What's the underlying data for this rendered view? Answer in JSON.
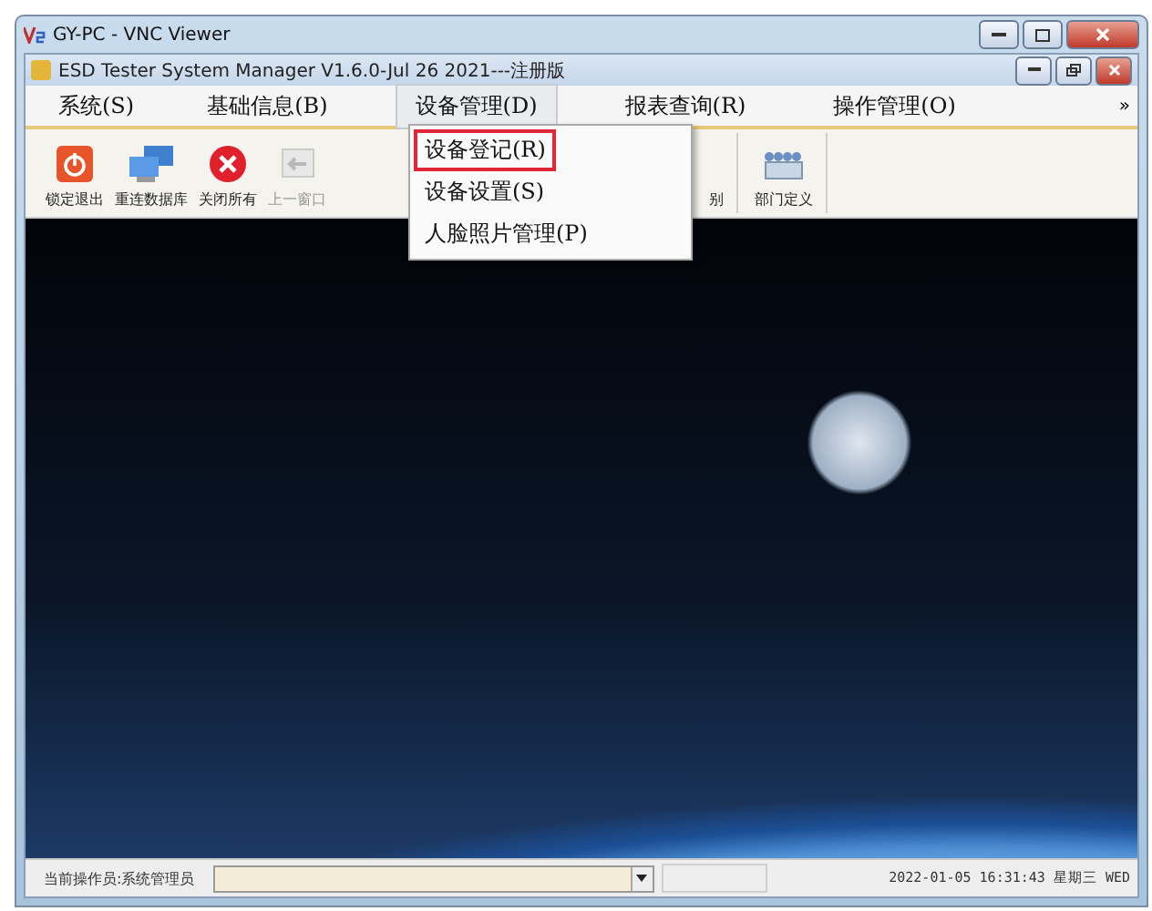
{
  "viewer_window": {
    "title": "GY-PC - VNC Viewer"
  },
  "app_window": {
    "title": "ESD Tester System Manager V1.6.0-Jul 26 2021---注册版"
  },
  "menu_bar": [
    {
      "label": "系统(S)",
      "open": false
    },
    {
      "label": "基础信息(B)",
      "open": false
    },
    {
      "label": "设备管理(D)",
      "open": true
    },
    {
      "label": "报表查询(R)",
      "open": false
    },
    {
      "label": "操作管理(O)",
      "open": false
    }
  ],
  "menu_overflow": "»",
  "dropdown": [
    {
      "label": "设备登记(R)",
      "selected": true
    },
    {
      "label": "设备设置(S)",
      "selected": false
    },
    {
      "label": "人脸照片管理(P)",
      "selected": false
    }
  ],
  "toolbar": [
    {
      "kind": "lock",
      "label": "锁定退出",
      "disabled": false
    },
    {
      "kind": "database",
      "label": "重连数据库",
      "disabled": false
    },
    {
      "kind": "close",
      "label": "关闭所有",
      "disabled": false
    },
    {
      "kind": "back",
      "label": "上一窗口",
      "disabled": true
    },
    {
      "kind": "covered",
      "label": "别",
      "disabled": false
    },
    {
      "kind": "people",
      "label": "部门定义",
      "disabled": false
    }
  ],
  "status_bar": {
    "operator": "当前操作员:系统管理员",
    "datetime": "2022-01-05 16:31:43 星期三 WED"
  }
}
